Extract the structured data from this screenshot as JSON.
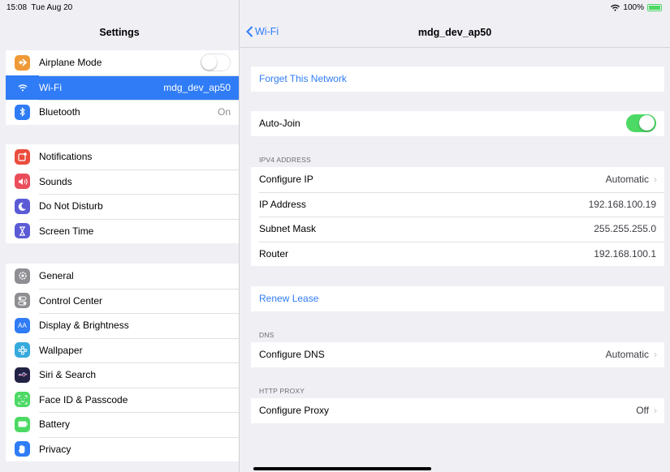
{
  "status_bar": {
    "time": "15:08",
    "date": "Tue Aug 20",
    "battery": "100%"
  },
  "sidebar": {
    "title": "Settings",
    "group1": [
      {
        "label": "Airplane Mode",
        "icon": "airplane-icon",
        "color": "#f09a37",
        "toggle": false
      },
      {
        "label": "Wi-Fi",
        "value": "mdg_dev_ap50",
        "icon": "wifi-icon",
        "color": "#2f7cf6",
        "selected": true
      },
      {
        "label": "Bluetooth",
        "value": "On",
        "icon": "bluetooth-icon",
        "color": "#2f7cf6"
      }
    ],
    "group2": [
      {
        "label": "Notifications",
        "icon": "notifications-icon",
        "color": "#eb4d3d"
      },
      {
        "label": "Sounds",
        "icon": "sounds-icon",
        "color": "#eb4d5b"
      },
      {
        "label": "Do Not Disturb",
        "icon": "moon-icon",
        "color": "#5b5bd6"
      },
      {
        "label": "Screen Time",
        "icon": "hourglass-icon",
        "color": "#5b5bd6"
      }
    ],
    "group3": [
      {
        "label": "General",
        "icon": "gear-icon",
        "color": "#8e8e93"
      },
      {
        "label": "Control Center",
        "icon": "control-center-icon",
        "color": "#8e8e93"
      },
      {
        "label": "Display & Brightness",
        "icon": "display-icon",
        "color": "#2f7cf6"
      },
      {
        "label": "Wallpaper",
        "icon": "wallpaper-icon",
        "color": "#35aadc"
      },
      {
        "label": "Siri & Search",
        "icon": "siri-icon",
        "color": "#222244"
      },
      {
        "label": "Face ID & Passcode",
        "icon": "face-id-icon",
        "color": "#4cd964"
      },
      {
        "label": "Battery",
        "icon": "battery-icon",
        "color": "#4cd964"
      },
      {
        "label": "Privacy",
        "icon": "hand-icon",
        "color": "#2f7cf6"
      }
    ]
  },
  "detail": {
    "back_label": "Wi-Fi",
    "title": "mdg_dev_ap50",
    "forget": "Forget This Network",
    "auto_join": {
      "label": "Auto-Join",
      "on": true
    },
    "ipv4_header": "IPV4 ADDRESS",
    "ipv4": [
      {
        "label": "Configure IP",
        "value": "Automatic",
        "chevron": true
      },
      {
        "label": "IP Address",
        "value": "192.168.100.19"
      },
      {
        "label": "Subnet Mask",
        "value": "255.255.255.0"
      },
      {
        "label": "Router",
        "value": "192.168.100.1"
      }
    ],
    "renew": "Renew Lease",
    "dns_header": "DNS",
    "dns": {
      "label": "Configure DNS",
      "value": "Automatic"
    },
    "proxy_header": "HTTP PROXY",
    "proxy": {
      "label": "Configure Proxy",
      "value": "Off"
    }
  }
}
